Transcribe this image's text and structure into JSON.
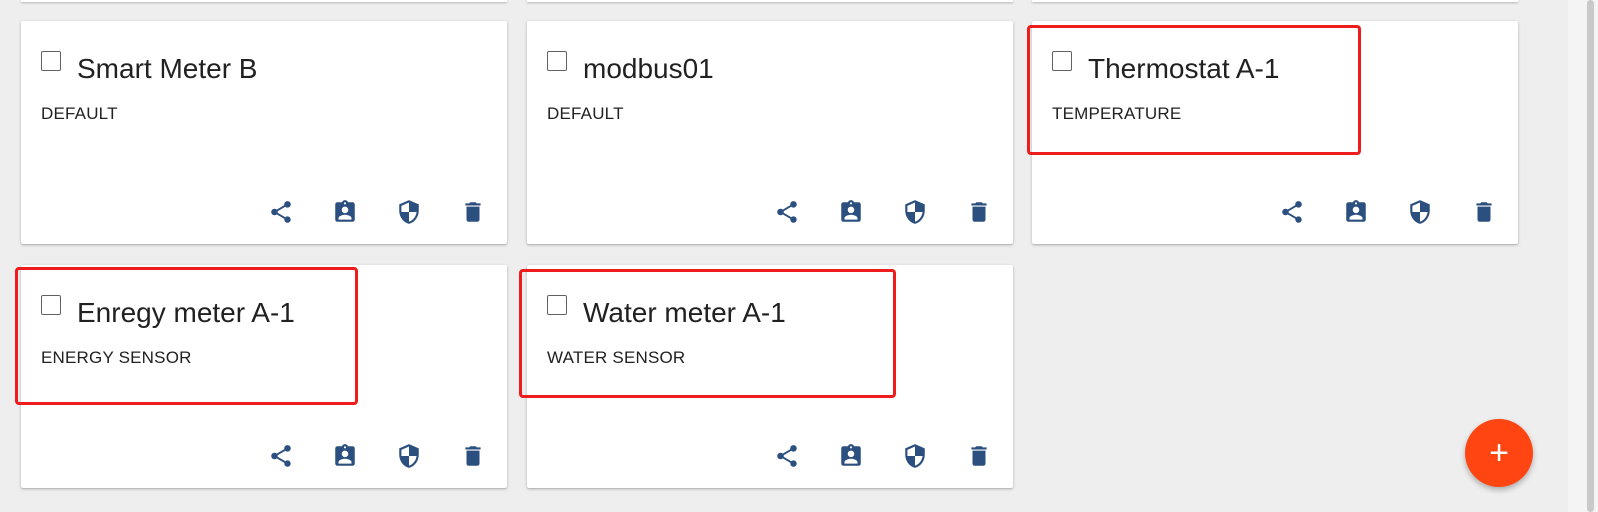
{
  "devices": [
    {
      "name": "Smart Meter B",
      "type": "DEFAULT"
    },
    {
      "name": "modbus01",
      "type": "DEFAULT"
    },
    {
      "name": "Thermostat A-1",
      "type": "TEMPERATURE"
    },
    {
      "name": "Enregy meter A-1",
      "type": "ENERGY SENSOR"
    },
    {
      "name": "Water meter A-1",
      "type": "WATER SENSOR"
    }
  ],
  "actions": [
    "share-icon",
    "assignment-icon",
    "security-icon",
    "delete-icon"
  ],
  "fab": {
    "label": "+"
  },
  "colors": {
    "icon": "#2b4f7f",
    "fab": "#ff4511",
    "highlight": "#ee1c1c",
    "background": "#eeeeee"
  }
}
